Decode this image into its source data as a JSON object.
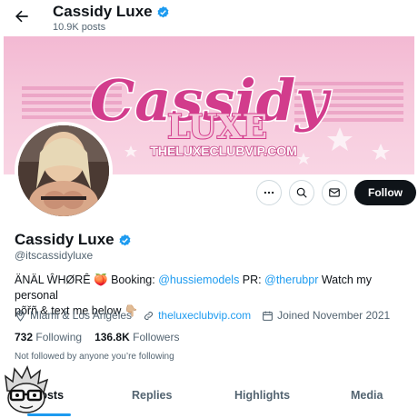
{
  "header": {
    "name": "Cassidy Luxe",
    "posts_count": "10.9K posts"
  },
  "banner": {
    "title_line1": "Cassidy",
    "title_line2": "LUXE",
    "url_text": "THELUXECLUBVIP.COM"
  },
  "actions": {
    "follow_label": "Follow"
  },
  "profile": {
    "display_name": "Cassidy Luxe",
    "handle": "@itscassidyluxe",
    "bio_part1": "ÄNÄL ŴHØRÊ 🍑 Booking: ",
    "bio_link1": "@hussiemodels",
    "bio_part2": " PR: ",
    "bio_link2": "@therubpr",
    "bio_part3": " Watch my personal",
    "bio_line2": "põřñ & text me below 👇🏼",
    "location": "Miami & Los Angeles",
    "website": "theluxeclubvip.com",
    "joined": "Joined November 2021",
    "following_count": "732",
    "following_label": "Following",
    "followers_count": "136.8K",
    "followers_label": "Followers",
    "not_followed_text": "Not followed by anyone you’re following"
  },
  "tabs": [
    {
      "label": "Posts"
    },
    {
      "label": "Replies"
    },
    {
      "label": "Highlights"
    },
    {
      "label": "Media"
    }
  ],
  "colors": {
    "accent": "#1d9bf0",
    "text": "#0f1419",
    "muted": "#536471",
    "banner_pink": "#f3b9d3",
    "banner_magenta": "#d23c8c"
  }
}
